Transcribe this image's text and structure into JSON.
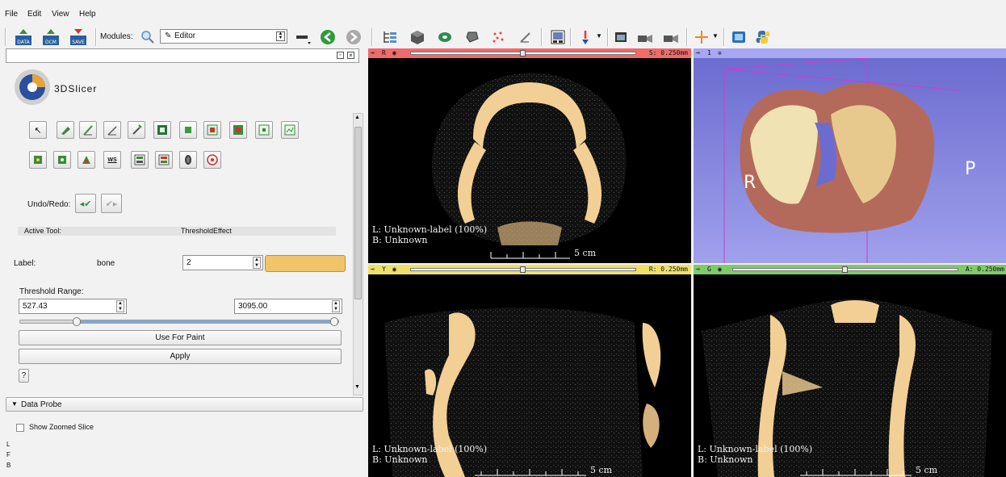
{
  "menubar": {
    "items": [
      "File",
      "Edit",
      "View",
      "Help"
    ]
  },
  "toolbar": {
    "data_label": "DATA",
    "dcm_label": "DCM",
    "save_label": "SAVE",
    "modules_label": "Modules:",
    "module_selected": "Editor"
  },
  "leftpanel": {
    "logo_text": "3DSlicer",
    "undo_redo_label": "Undo/Redo:",
    "active_tool_label": "Active Tool:",
    "active_tool_value": "ThresholdEffect",
    "label_label": "Label:",
    "label_name": "bone",
    "label_value": "2",
    "threshold_range_label": "Threshold Range:",
    "threshold_min": "527.43",
    "threshold_max": "3095.00",
    "threshold_min_fraction": 0.17,
    "threshold_max_fraction": 1.0,
    "use_for_paint_label": "Use For Paint",
    "apply_label": "Apply",
    "help_label": "?",
    "ws_label": "WS",
    "data_probe_title": "Data Probe",
    "show_zoomed_label": "Show Zoomed Slice",
    "probe_lines": [
      "L",
      "F",
      "B"
    ],
    "label_color": "#f2c46a"
  },
  "viewers": {
    "red": {
      "letter": "R",
      "offset": "S: 0.250mm",
      "slider_fraction": 0.5,
      "line1": "L: Unknown-label (100%)",
      "line2": "B: Unknown",
      "scale": "5 cm",
      "bar_color": "#f06a6a"
    },
    "threed": {
      "number": "1",
      "left_marker": "R",
      "right_marker": "P",
      "bar_color": "#a7a7f2",
      "background": "#7a7ad8"
    },
    "yellow": {
      "letter": "Y",
      "offset": "R: 0.250mm",
      "slider_fraction": 0.5,
      "line1": "L: Unknown-label (100%)",
      "line2": "B: Unknown",
      "scale": "5 cm",
      "bar_color": "#f0e06a"
    },
    "green": {
      "letter": "G",
      "offset": "A: 0.250mm",
      "slider_fraction": 0.5,
      "line1": "L: Unknown-label (100%)",
      "line2": "B: Unknown",
      "scale": "5 cm",
      "bar_color": "#7fca6a"
    }
  }
}
